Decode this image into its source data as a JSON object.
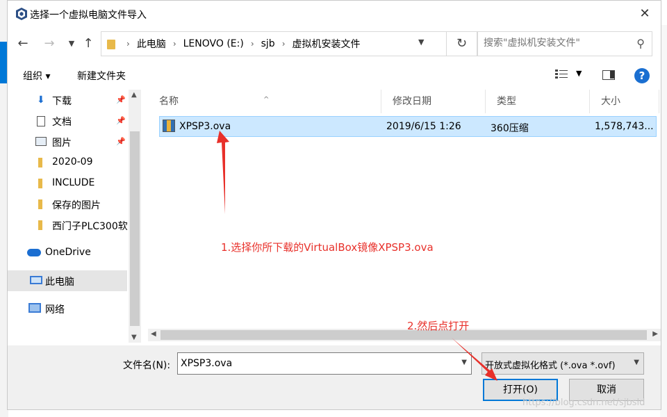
{
  "window": {
    "title": "选择一个虚拟电脑文件导入",
    "close_label": "✕"
  },
  "address": {
    "crumbs": [
      "此电脑",
      "LENOVO (E:)",
      "sjb",
      "虚拟机安装文件"
    ],
    "search_placeholder": "搜索\"虚拟机安装文件\""
  },
  "toolbar": {
    "organize_label": "组织 ▾",
    "new_folder_label": "新建文件夹"
  },
  "nav": {
    "items": [
      {
        "label": "下载",
        "pinned": true
      },
      {
        "label": "文档",
        "pinned": true
      },
      {
        "label": "图片",
        "pinned": true
      },
      {
        "label": "2020-09",
        "pinned": false
      },
      {
        "label": "INCLUDE",
        "pinned": false
      },
      {
        "label": "保存的图片",
        "pinned": false
      },
      {
        "label": "西门子PLC300软",
        "pinned": false
      },
      {
        "label": "OneDrive",
        "pinned": false
      },
      {
        "label": "此电脑",
        "pinned": false,
        "selected": true
      },
      {
        "label": "网络",
        "pinned": false
      }
    ]
  },
  "files": {
    "columns": [
      "名称",
      "修改日期",
      "类型",
      "大小"
    ],
    "rows": [
      {
        "name": "XPSP3.ova",
        "modified": "2019/6/15 1:26",
        "type": "360压缩",
        "size": "1,578,743..."
      }
    ]
  },
  "bottom": {
    "filename_label": "文件名(N):",
    "filename_value": "XPSP3.ova",
    "filetype_value": "开放式虚拟化格式 (*.ova *.ovf)",
    "open_label": "打开(O)",
    "cancel_label": "取消"
  },
  "annotations": {
    "step1": "1.选择你所下载的VirtualBox镜像XPSP3.ova",
    "step2": "2.然后点打开",
    "color": "#e8302a"
  },
  "watermark": "https://blog.csdn.net/sjbsld"
}
